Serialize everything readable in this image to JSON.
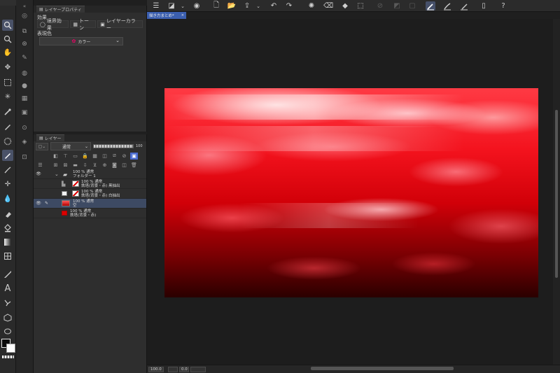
{
  "properties_panel": {
    "tab_label": "レイヤープロパティ",
    "effect_section_label": "効果",
    "effects": [
      {
        "label": "境界効果",
        "icon": "circle-outline-icon"
      },
      {
        "label": "トーン",
        "icon": "tone-grid-icon"
      },
      {
        "label": "レイヤーカラー",
        "icon": "layer-color-icon"
      }
    ],
    "expression_color_label": "表現色",
    "expression_color_value": "カラー"
  },
  "layer_panel": {
    "tab_label": "レイヤー",
    "blend_mode": "通常",
    "opacity": "100",
    "layers": [
      {
        "blend": "100 % 通常",
        "name": "フォルダー 1",
        "kind": "folder",
        "visible": true,
        "selected": false
      },
      {
        "blend": "100 % 通常",
        "name": "鉄塔(背景・赤)  黒抽出",
        "kind": "raster",
        "visible": false,
        "selected": false
      },
      {
        "blend": "100 % 通常",
        "name": "鉄塔(背景・赤)  白抽出",
        "kind": "raster",
        "visible": false,
        "selected": false
      },
      {
        "blend": "100 % 通常",
        "name": "空",
        "kind": "raster",
        "visible": true,
        "selected": true
      },
      {
        "blend": "100 % 通常",
        "name": "鉄塔(背景・赤)",
        "kind": "raster",
        "visible": false,
        "selected": false
      }
    ]
  },
  "document": {
    "tab_label": "描き方まとめ*",
    "tab_close": "×"
  },
  "status": {
    "zoom": "100.0",
    "angle": "0.0"
  },
  "colors": {
    "main_color": "#0b0b0b",
    "sub_color": "#ffffff",
    "selected_layer_bg": "#3d4a63",
    "accent_blue": "#3b5fb0"
  }
}
